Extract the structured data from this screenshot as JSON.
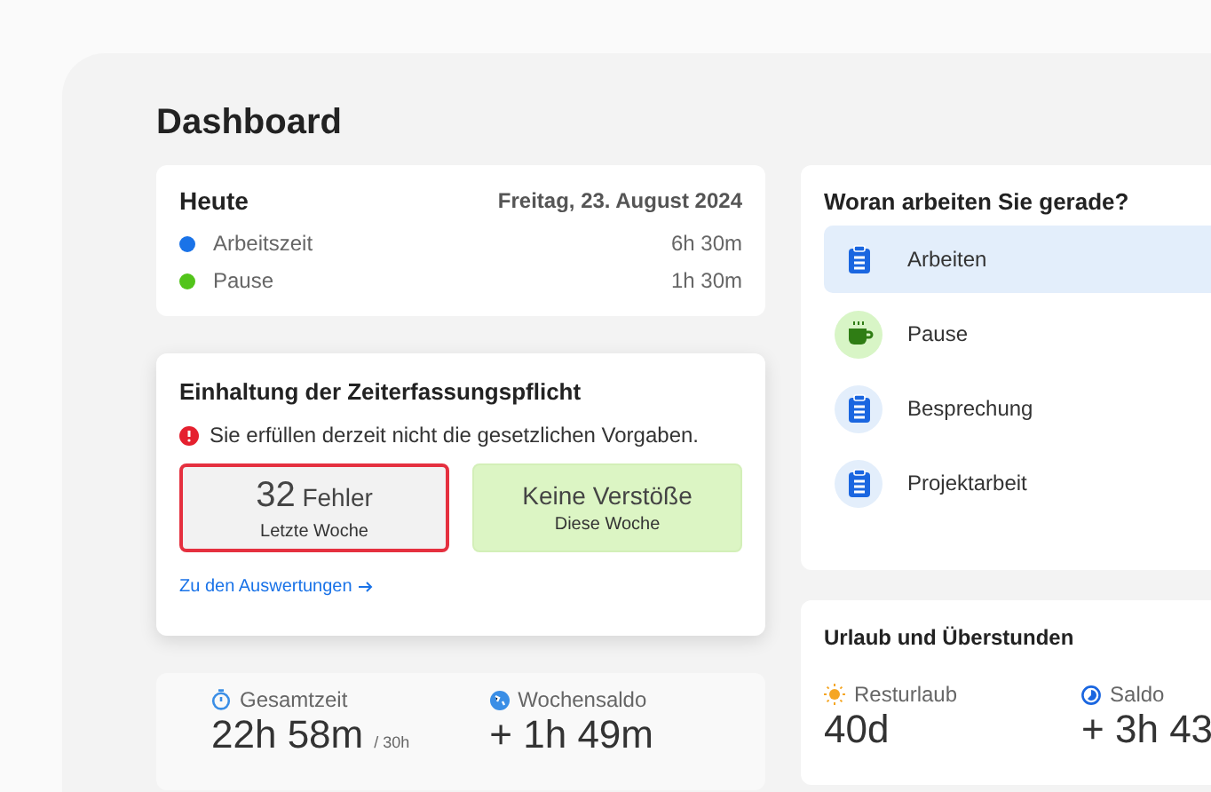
{
  "title": "Dashboard",
  "today": {
    "title": "Heute",
    "date": "Freitag, 23. August 2024",
    "entries": [
      {
        "label": "Arbeitszeit",
        "value": "6h 30m",
        "color": "#1a73e8"
      },
      {
        "label": "Pause",
        "value": "1h 30m",
        "color": "#52c41a"
      }
    ]
  },
  "compliance": {
    "title": "Einhaltung der Zeiterfassungspflicht",
    "warning": "Sie erfüllen derzeit nicht die gesetzlichen Vorgaben.",
    "tiles": [
      {
        "kind": "error",
        "number": "32",
        "text": "Fehler",
        "caption": "Letzte Woche"
      },
      {
        "kind": "ok",
        "text": "Keine Verstöße",
        "caption": "Diese Woche"
      }
    ],
    "link": "Zu den Auswertungen"
  },
  "week": {
    "stats": [
      {
        "kind": "timer",
        "label": "Gesamtzeit",
        "value": "22h 58m",
        "suffix": "/ 30h"
      },
      {
        "kind": "balance",
        "label": "Wochensaldo",
        "value": "+ 1h 49m"
      }
    ]
  },
  "activity": {
    "title": "Woran arbeiten Sie gerade?",
    "items": [
      {
        "kind": "work",
        "label": "Arbeiten",
        "selected": true
      },
      {
        "kind": "pause",
        "label": "Pause",
        "selected": false
      },
      {
        "kind": "work",
        "label": "Besprechung",
        "selected": false
      },
      {
        "kind": "work",
        "label": "Projektarbeit",
        "selected": false
      }
    ]
  },
  "vacation": {
    "title": "Urlaub und Überstunden",
    "stats": [
      {
        "kind": "sun",
        "label": "Resturlaub",
        "value": "40d"
      },
      {
        "kind": "clock",
        "label": "Saldo",
        "value": "+ 3h 43"
      }
    ]
  }
}
